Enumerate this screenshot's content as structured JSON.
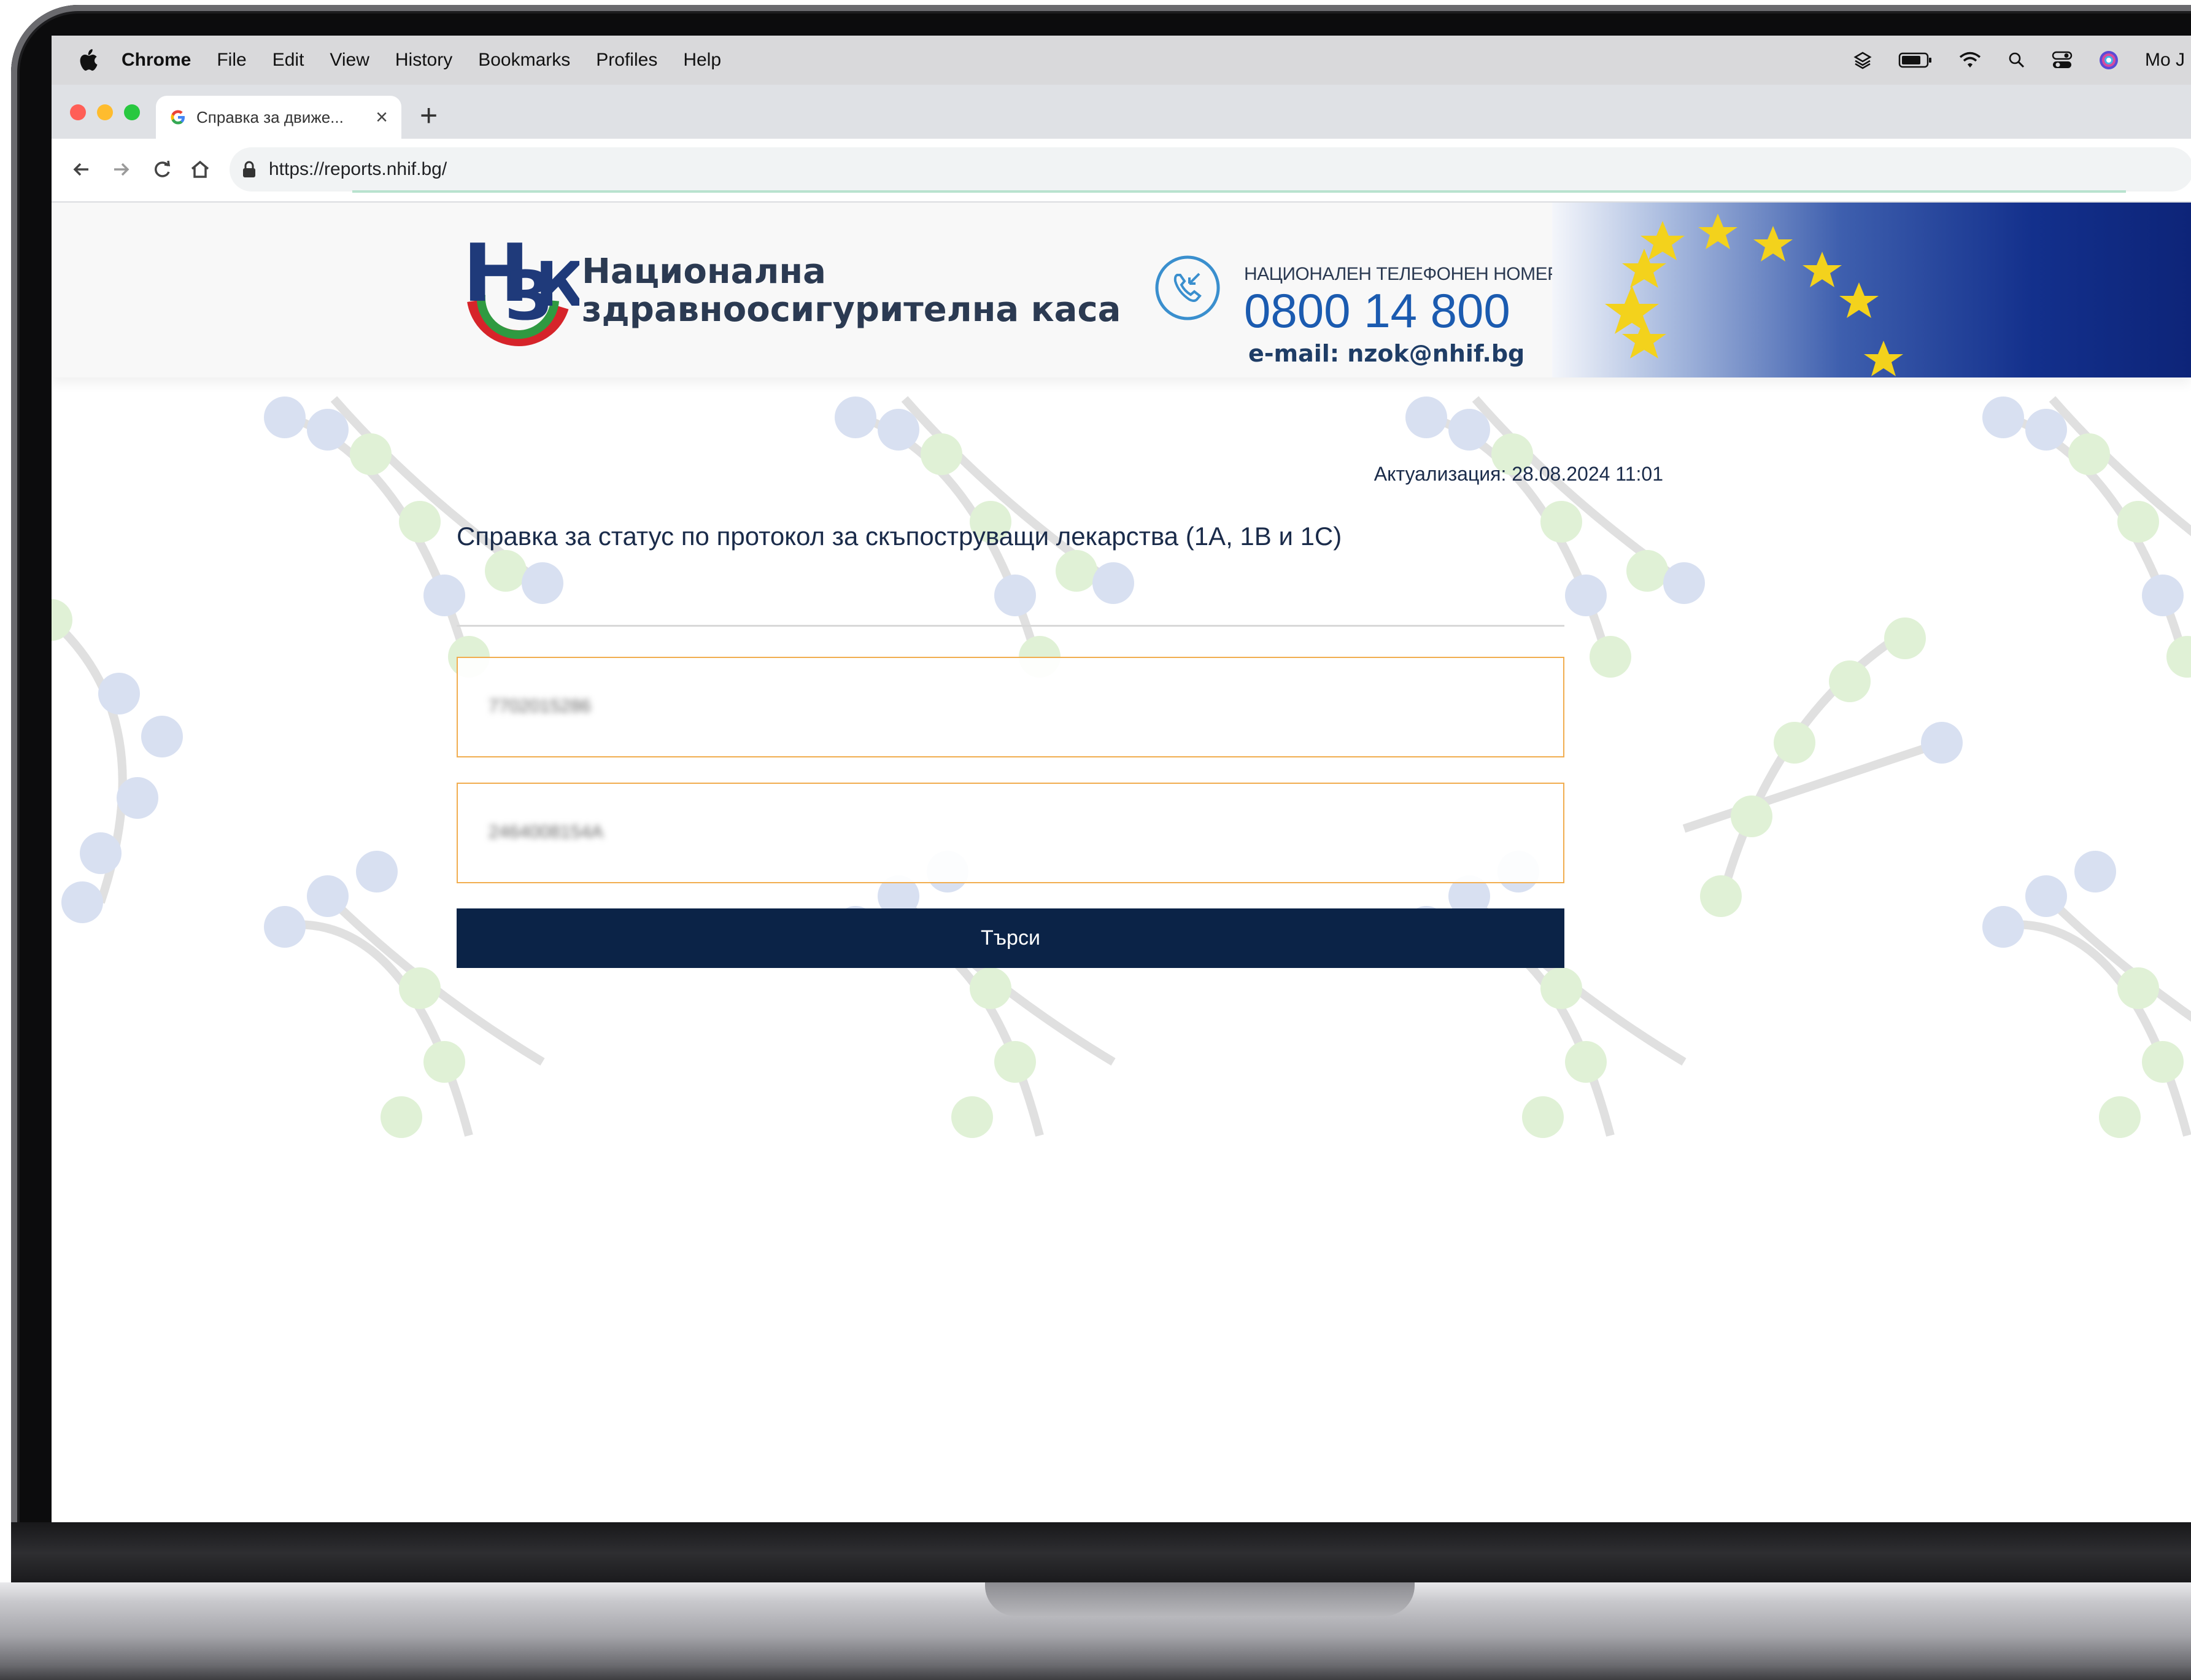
{
  "menubar": {
    "app_name": "Chrome",
    "items": [
      "File",
      "Edit",
      "View",
      "History",
      "Bookmarks",
      "Profiles",
      "Help"
    ],
    "user": "Mo J"
  },
  "browser": {
    "tab_title": "Справка за движе...",
    "tab_close": "×",
    "new_tab": "+",
    "url": "https://reports.nhif.bg/"
  },
  "header": {
    "org_name_line1": "Национална",
    "org_name_line2": "здравноосигурителна каса",
    "phone_label": "НАЦИОНАЛЕН ТЕЛЕФОНЕН НОМЕР",
    "phone_number": "0800 14 800",
    "email": "e-mail: nzok@nhif.bg",
    "logo_letters": "НЗК"
  },
  "main": {
    "updated": "Актуализация: 28.08.2024 11:01",
    "title": "Справка за статус по протокол за скъпоструващи лекарства (1А, 1В и 1С)",
    "field1_value": "7702015286",
    "field2_value": "2464008154A",
    "search_button": "Търси"
  },
  "colors": {
    "navy": "#0b2347",
    "field_border": "#f1ad4f",
    "phone_blue": "#1b5bb0",
    "logo_red": "#d6242a",
    "logo_green": "#2f9a41",
    "logo_navy": "#1f3a7a"
  }
}
